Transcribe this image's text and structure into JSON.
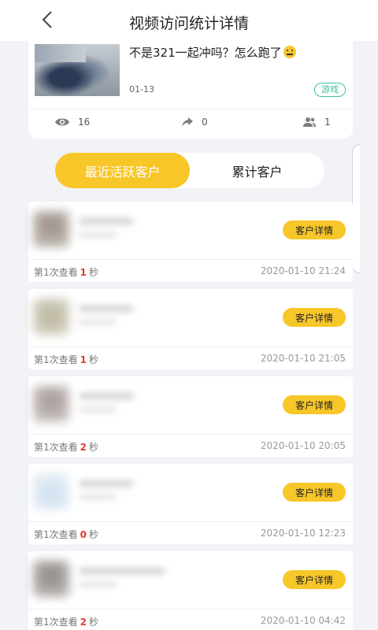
{
  "header": {
    "title": "视频访问统计详情",
    "back_icon": "chevron-left-icon"
  },
  "video": {
    "caption": "不是321一起冲吗？怎么跑了",
    "emoji": "confused-face-icon",
    "date": "01-13",
    "tag": "游戏",
    "stats": {
      "views": "16",
      "shares": "0",
      "users": "1"
    }
  },
  "tabs": {
    "recent": "最近活跃客户",
    "total": "累计客户"
  },
  "colors": {
    "accent": "#f7c629",
    "tag": "#3cc2a0",
    "count_red": "#e53935"
  },
  "customers": [
    {
      "view_prefix": "第1次查看",
      "view_count": "1",
      "view_unit": "秒",
      "time": "2020-01-10 21:24",
      "button": "客户详情"
    },
    {
      "view_prefix": "第1次查看",
      "view_count": "1",
      "view_unit": "秒",
      "time": "2020-01-10 21:05",
      "button": "客户详情"
    },
    {
      "view_prefix": "第1次查看",
      "view_count": "2",
      "view_unit": "秒",
      "time": "2020-01-10 20:05",
      "button": "客户详情"
    },
    {
      "view_prefix": "第1次查看",
      "view_count": "0",
      "view_unit": "秒",
      "time": "2020-01-10 12:23",
      "button": "客户详情"
    },
    {
      "view_prefix": "第1次查看",
      "view_count": "2",
      "view_unit": "秒",
      "time": "2020-01-10 04:42",
      "button": "客户详情"
    }
  ]
}
